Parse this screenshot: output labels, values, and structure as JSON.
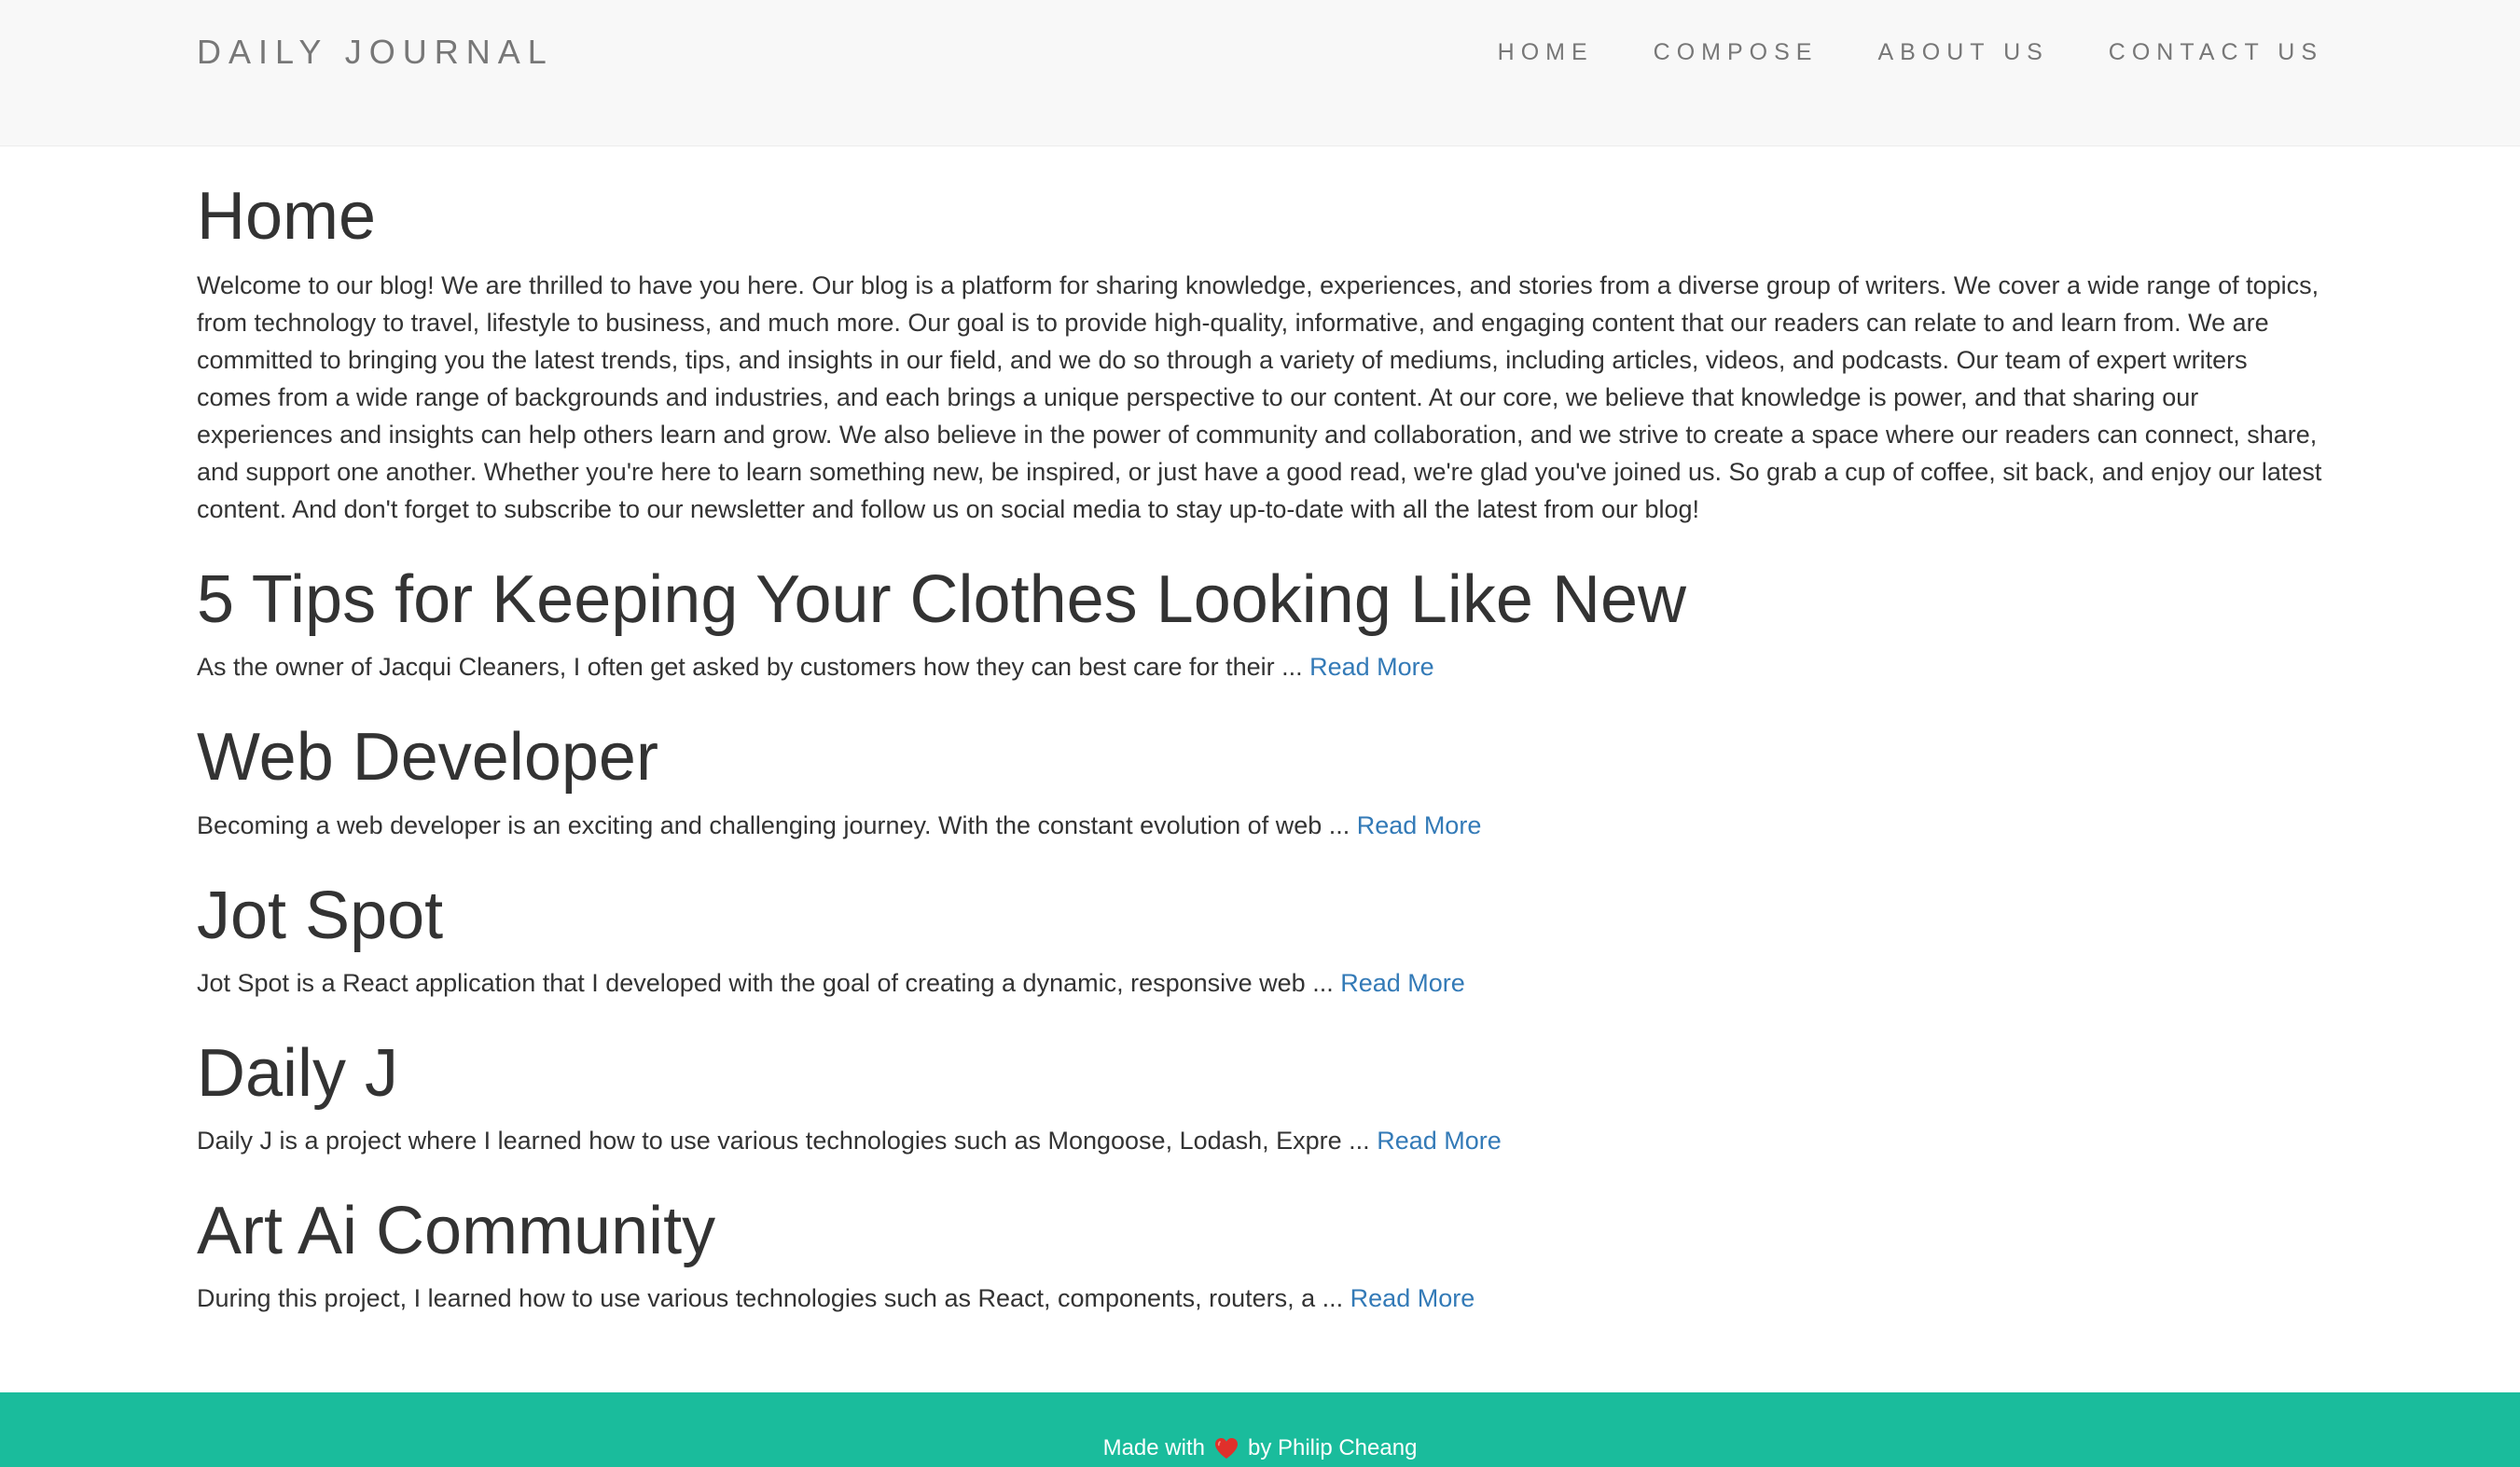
{
  "navbar": {
    "brand": "DAILY JOURNAL",
    "links": [
      "HOME",
      "COMPOSE",
      "ABOUT US",
      "CONTACT US"
    ]
  },
  "main": {
    "title": "Home",
    "intro": "Welcome to our blog! We are thrilled to have you here. Our blog is a platform for sharing knowledge, experiences, and stories from a diverse group of writers. We cover a wide range of topics, from technology to travel, lifestyle to business, and much more. Our goal is to provide high-quality, informative, and engaging content that our readers can relate to and learn from. We are committed to bringing you the latest trends, tips, and insights in our field, and we do so through a variety of mediums, including articles, videos, and podcasts. Our team of expert writers comes from a wide range of backgrounds and industries, and each brings a unique perspective to our content. At our core, we believe that knowledge is power, and that sharing our experiences and insights can help others learn and grow. We also believe in the power of community and collaboration, and we strive to create a space where our readers can connect, share, and support one another. Whether you're here to learn something new, be inspired, or just have a good read, we're glad you've joined us. So grab a cup of coffee, sit back, and enjoy our latest content. And don't forget to subscribe to our newsletter and follow us on social media to stay up-to-date with all the latest from our blog!",
    "posts": [
      {
        "title": "5 Tips for Keeping Your Clothes Looking Like New",
        "excerpt": "As the owner of Jacqui Cleaners, I often get asked by customers how they can best care for their ...",
        "link": "Read More"
      },
      {
        "title": "Web Developer",
        "excerpt": "Becoming a web developer is an exciting and challenging journey. With the constant evolution of web ...",
        "link": "Read More"
      },
      {
        "title": "Jot Spot",
        "excerpt": "Jot Spot is a React application that I developed with the goal of creating a dynamic, responsive web ...",
        "link": "Read More"
      },
      {
        "title": "Daily J",
        "excerpt": "Daily J is a project where I learned how to use various technologies such as Mongoose, Lodash, Expre ...",
        "link": "Read More"
      },
      {
        "title": "Art Ai Community",
        "excerpt": "During this project, I learned how to use various technologies such as React, components, routers, a ...",
        "link": "Read More"
      }
    ]
  },
  "footer": {
    "prefix": "Made with",
    "icon": "heart-icon",
    "suffix": "by Philip Cheang"
  },
  "colors": {
    "navbar_bg": "#f8f8f8",
    "footer_bg": "#1abc9c",
    "link": "#337ab7",
    "text": "#333333",
    "nav_text": "#777777",
    "heart": "#e0302b"
  }
}
